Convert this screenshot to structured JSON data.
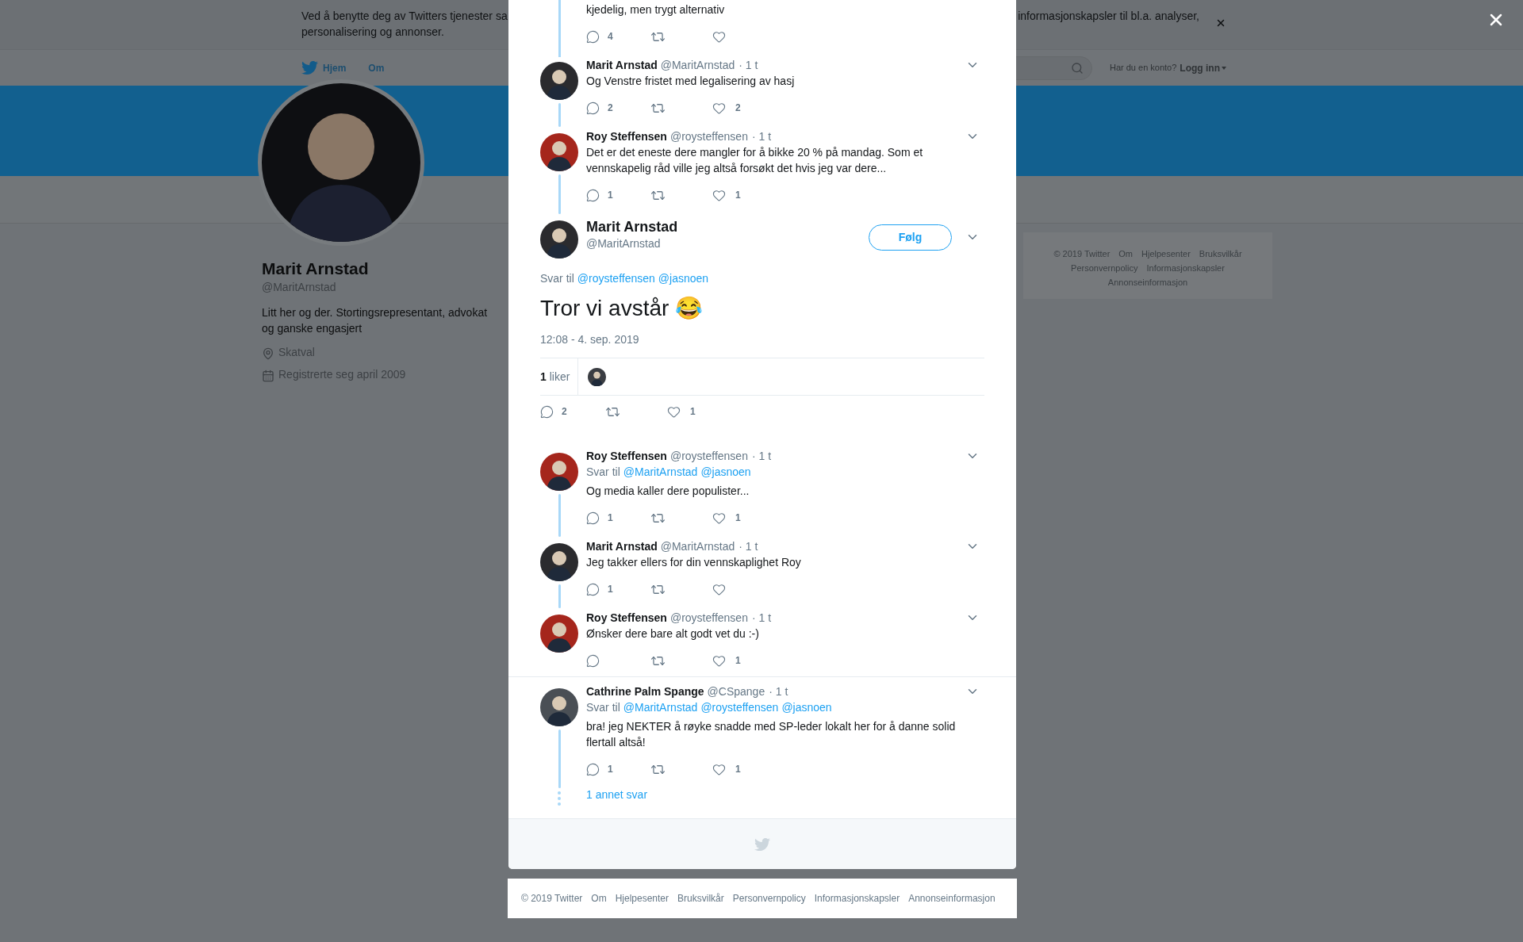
{
  "cookie_banner": {
    "text_left": [
      "Ved å benytte deg av Twitters tjenester sa",
      "personalisering og annonser."
    ],
    "text_right": "informasjonskapsler til bl.a. analyser,"
  },
  "nav": {
    "items": [
      {
        "label": "Hjem",
        "kind": "home"
      },
      {
        "label": "Om",
        "kind": "link"
      }
    ],
    "account_prompt": "Har du en konto?",
    "login": "Logg inn"
  },
  "profile": {
    "name": "Marit Arnstad",
    "handle": "@MaritArnstad",
    "bio": "Litt her og der. Stortingsrepresentant, advokat og ganske engasjert",
    "location": "Skatval",
    "joined": "Registrerte seg april 2009"
  },
  "side_footer": [
    "© 2019 Twitter",
    "Om",
    "Hjelpesenter",
    "Bruksvilkår",
    "Personvernpolicy",
    "Informasjonskapsler",
    "Annonseinformasjon"
  ],
  "thread_above": [
    {
      "kind": "fragment",
      "text": "kjedelig, men trygt alternativ",
      "replies": "4"
    },
    {
      "kind": "tweet",
      "color": "#2b2b2e",
      "name": "Marit Arnstad",
      "handle": "@MaritArnstad",
      "time": "· 1 t",
      "text": "Og Venstre fristet med legalisering av hasj",
      "replies": "2",
      "likes": "2"
    },
    {
      "kind": "tweet",
      "color": "#a5261c",
      "name": "Roy Steffensen",
      "handle": "@roysteffensen",
      "time": "· 1 t",
      "text": "Det er det eneste dere mangler for å bikke 20 % på mandag. Som et vennskapelig råd ville jeg altså forsøkt det hvis jeg var dere...",
      "replies": "1",
      "likes": "1"
    }
  ],
  "main_tweet": {
    "color": "#2b2b2e",
    "name": "Marit Arnstad",
    "handle": "@MaritArnstad",
    "follow": "Følg",
    "reply_label": "Svar til",
    "reply_to": [
      "@roysteffensen",
      "@jasnoen"
    ],
    "text": "Tror vi avstår 😂",
    "date": "12:08 - 4. sep. 2019",
    "like_count": "1",
    "like_label": "liker",
    "replies": "2",
    "likes": "1"
  },
  "conversations": [
    {
      "tweets": [
        {
          "color": "#a5261c",
          "name": "Roy Steffensen",
          "handle": "@roysteffensen",
          "time": "· 1 t",
          "reply_label": "Svar til",
          "reply_to": [
            "@MaritArnstad",
            "@jasnoen"
          ],
          "text": "Og media kaller dere populister...",
          "replies": "1",
          "likes": "1"
        },
        {
          "color": "#2b2b2e",
          "name": "Marit Arnstad",
          "handle": "@MaritArnstad",
          "time": "· 1 t",
          "text": "Jeg takker ellers for din vennskaplighet Roy",
          "replies": "1"
        },
        {
          "color": "#a5261c",
          "name": "Roy Steffensen",
          "handle": "@roysteffensen",
          "time": "· 1 t",
          "text": "Ønsker dere bare alt godt vet du :-)",
          "likes": "1"
        }
      ]
    },
    {
      "tweets": [
        {
          "color": "#4a4f55",
          "name": "Cathrine Palm Spange",
          "handle": "@CSpange",
          "time": "· 1 t",
          "reply_label": "Svar til",
          "reply_to": [
            "@MaritArnstad",
            "@roysteffensen",
            "@jasnoen"
          ],
          "text": "bra! jeg NEKTER å røyke snadde med SP-leder lokalt her for å danne solid flertall altså!",
          "replies": "1",
          "likes": "1"
        }
      ],
      "more": "1 annet svar"
    }
  ],
  "footer": [
    "© 2019 Twitter",
    "Om",
    "Hjelpesenter",
    "Bruksvilkår",
    "Personvernpolicy",
    "Informasjonskapsler",
    "Annonseinformasjon"
  ]
}
